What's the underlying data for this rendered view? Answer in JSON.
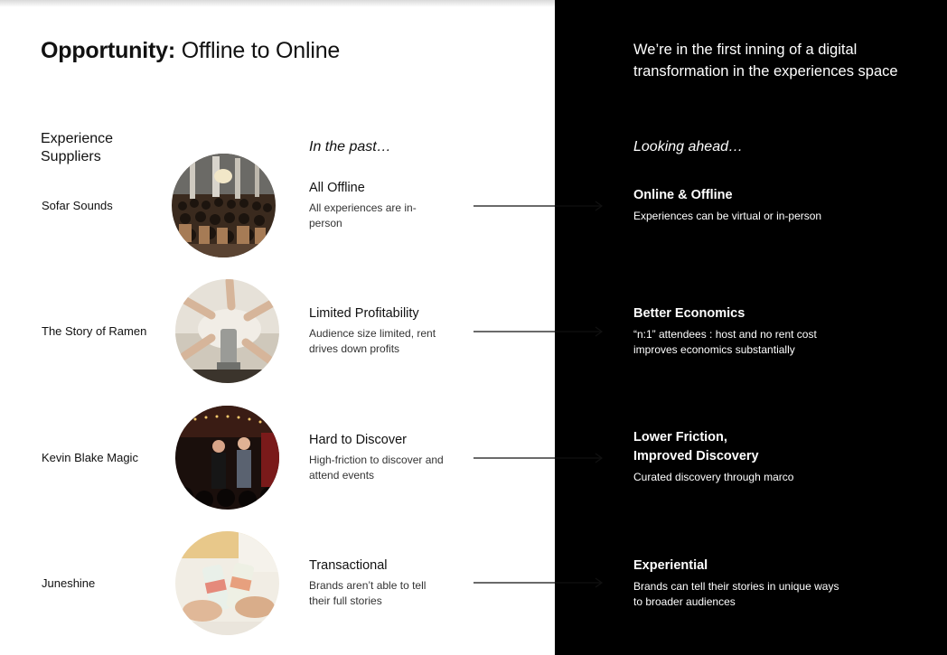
{
  "slide": {
    "title_bold": "Opportunity:",
    "title_rest": " Offline to Online",
    "headline": "We’re in the first inning of a digital transformation in the experiences space"
  },
  "columns": {
    "suppliers": "Experience Suppliers",
    "past": "In the past…",
    "ahead": "Looking ahead…"
  },
  "rows": [
    {
      "supplier": "Sofar Sounds",
      "past_title": "All Offline",
      "past_desc": "All experiences are in-person",
      "ahead_title": "Online & Offline",
      "ahead_desc": "Experiences can be virtual or in-person"
    },
    {
      "supplier": "The Story of Ramen",
      "past_title": "Limited Profitability",
      "past_desc": "Audience size limited, rent drives down profits",
      "ahead_title": "Better Economics",
      "ahead_desc": "“n:1” attendees : host and no rent cost improves economics substantially"
    },
    {
      "supplier": "Kevin Blake Magic",
      "past_title": "Hard to Discover",
      "past_desc": "High-friction to discover and attend events",
      "ahead_title": "Lower Friction, Improved Discovery",
      "ahead_desc": "Curated discovery through marco"
    },
    {
      "supplier": "Juneshine",
      "past_title": "Transactional",
      "past_desc": "Brands aren’t able to tell their full stories",
      "ahead_title": "Experiential",
      "ahead_desc": "Brands can tell their stories in unique ways to broader audiences"
    }
  ],
  "colors": {
    "right_panel": "#000000",
    "left_panel": "#ffffff",
    "text_dark": "#111111"
  }
}
